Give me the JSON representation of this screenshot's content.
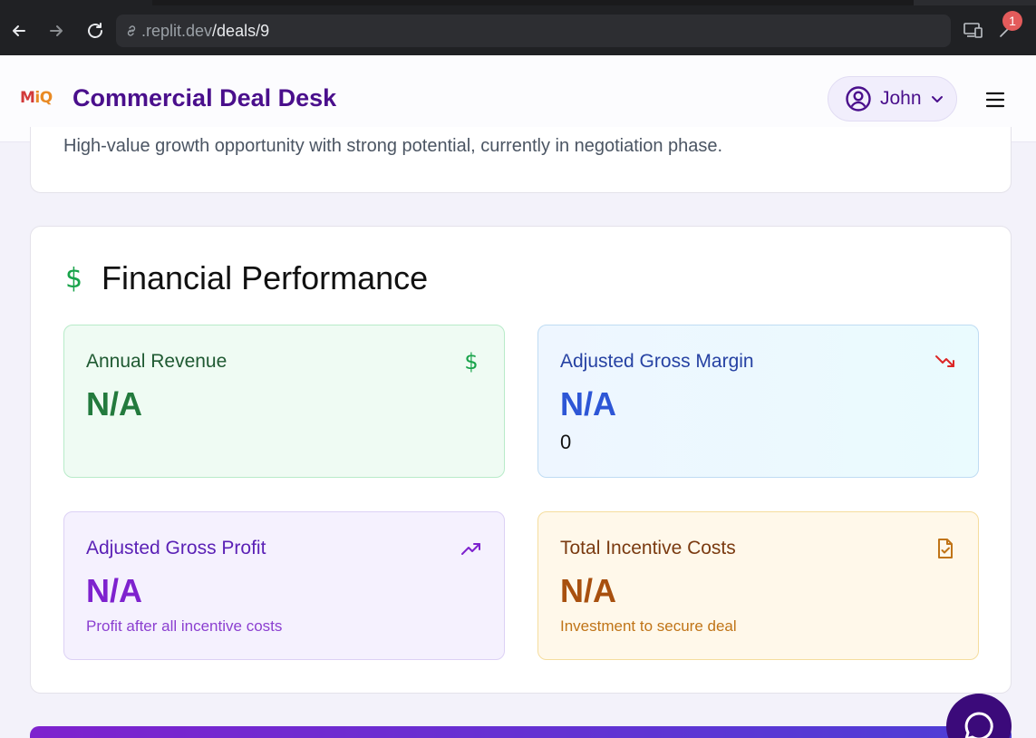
{
  "browser": {
    "url_host": ".replit.dev",
    "url_path": "/deals/9",
    "notification_count": "1"
  },
  "header": {
    "logo_m": "M",
    "logo_iq": "iQ",
    "title": "Commercial Deal Desk",
    "user_name": "John"
  },
  "summary": {
    "description": "High-value growth opportunity with strong potential, currently in negotiation phase."
  },
  "financial": {
    "title": "Financial Performance",
    "tiles": {
      "revenue": {
        "label": "Annual Revenue",
        "value": "N/A"
      },
      "margin": {
        "label": "Adjusted Gross Margin",
        "value": "N/A",
        "sub": "0"
      },
      "profit": {
        "label": "Adjusted Gross Profit",
        "value": "N/A",
        "sub": "Profit after all incentive costs"
      },
      "costs": {
        "label": "Total Incentive Costs",
        "value": "N/A",
        "sub": "Investment to secure deal"
      }
    }
  },
  "colors": {
    "brand_purple": "#4a0f8c",
    "green": "#18a34a",
    "blue": "#2d56d6",
    "purple": "#7e22ce",
    "amber": "#a8500f",
    "red": "#dc2626"
  },
  "icons": {
    "revenue": "dollar-icon",
    "margin": "trending-down-icon",
    "profit": "trending-up-icon",
    "costs": "file-check-icon"
  }
}
